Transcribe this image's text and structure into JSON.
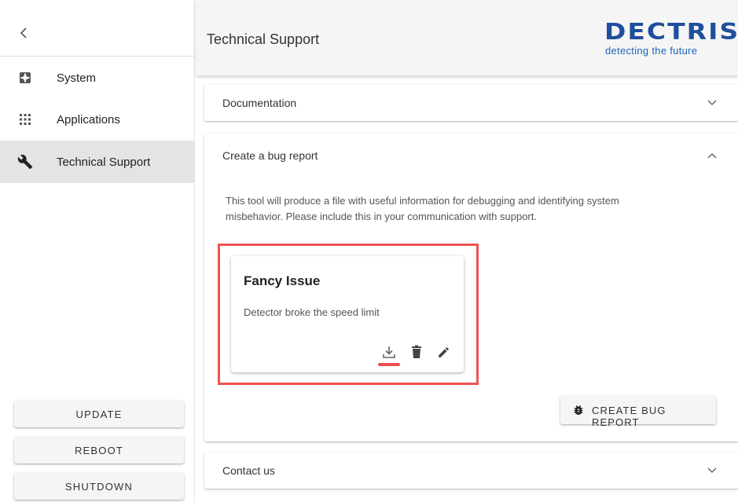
{
  "sidebar": {
    "collapse_icon": "chevron-left-icon",
    "items": [
      {
        "label": "System",
        "icon": "system-icon"
      },
      {
        "label": "Applications",
        "icon": "apps-grid-icon"
      },
      {
        "label": "Technical Support",
        "icon": "wrench-icon",
        "active": true
      }
    ],
    "buttons": {
      "update": "UPDATE",
      "reboot": "REBOOT",
      "shutdown": "SHUTDOWN"
    }
  },
  "header": {
    "title": "Technical Support",
    "logo_word": "DECTRIS",
    "logo_tagline": "detecting the future",
    "brand_color": "#1f4e9c"
  },
  "panels": {
    "documentation": {
      "title": "Documentation",
      "expanded": false
    },
    "bug_report": {
      "title": "Create a bug report",
      "expanded": true,
      "description": "This tool will produce a file with useful information for debugging and identifying system misbehavior. Please include this in your communication with support.",
      "card": {
        "title": "Fancy Issue",
        "description": "Detector broke the speed limit",
        "actions": [
          "download-icon",
          "delete-icon",
          "edit-icon"
        ]
      },
      "create_button": "CREATE BUG REPORT",
      "create_icon": "bug-icon"
    },
    "contact": {
      "title": "Contact us",
      "expanded": false
    }
  },
  "colors": {
    "highlight": "#ee5253",
    "active_nav_bg": "#e4e4e4",
    "header_bg": "#f5f5f5"
  }
}
